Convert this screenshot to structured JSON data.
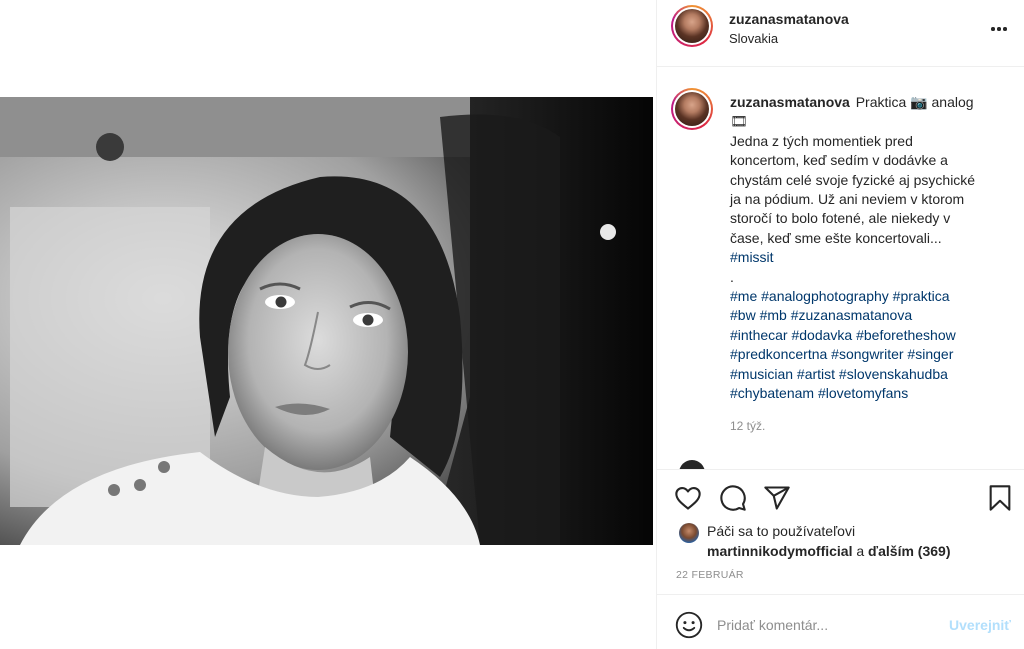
{
  "post": {
    "username": "zuzanasmatanova",
    "location": "Slovakia",
    "more_icon": "more-options-icon"
  },
  "caption": {
    "username": "zuzanasmatanova",
    "lines": [
      "Praktica 📷 analog",
      "🎞",
      "Jedna z tých momentiek pred",
      "koncertom, keď sedím v dodávke a",
      "chystám celé svoje fyzické aj psychické",
      "ja na pódium. Už ani neviem v ktorom",
      "storočí to bolo fotené, ale niekedy v",
      "čase, keď sme ešte koncertovali...",
      "#missit",
      ".",
      "#me #analogphotography #praktica",
      "#bw #mb #zuzanasmatanova",
      "#inthecar #dodavka #beforetheshow",
      "#predkoncertna #songwriter #singer",
      "#musician #artist #slovenskahudba",
      "#chybatenam #lovetomyfans"
    ],
    "time_ago": "12 týž."
  },
  "actions": {
    "like_icon": "heart-icon",
    "comment_icon": "comment-icon",
    "share_icon": "share-icon",
    "save_icon": "bookmark-icon"
  },
  "likes": {
    "prefix": "Páči sa to používateľovi",
    "user": "martinnikodymofficial",
    "connector": "a",
    "others": "ďalším (369)"
  },
  "date": "22 FEBRUÁR",
  "comment": {
    "placeholder": "Pridať komentár...",
    "publish_label": "Uverejniť",
    "emoji_icon": "emoji-icon"
  },
  "colors": {
    "hashtag": "#00376b",
    "muted": "#8e8e8e",
    "publish_disabled": "#b2dffc"
  }
}
